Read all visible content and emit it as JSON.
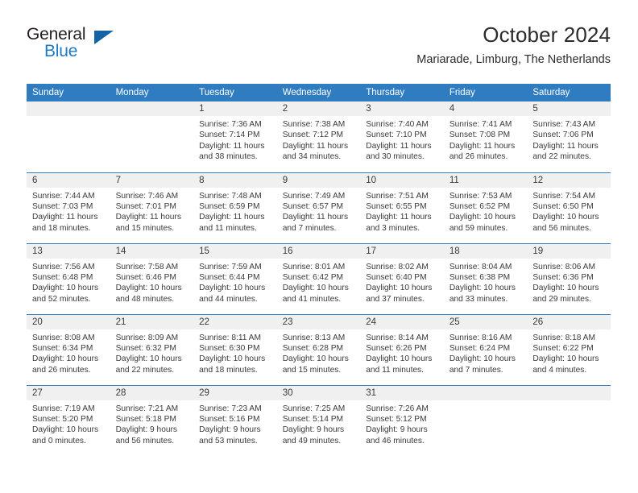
{
  "brand": {
    "name_top": "General",
    "name_bottom": "Blue",
    "accent_color": "#1f7ac4",
    "triangle_color": "#1463a5"
  },
  "header": {
    "title": "October 2024",
    "subtitle": "Mariarade, Limburg, The Netherlands"
  },
  "calendar": {
    "header_bg": "#2f7cc0",
    "daynum_bg": "#f0f0f0",
    "weekday_headers": [
      "Sunday",
      "Monday",
      "Tuesday",
      "Wednesday",
      "Thursday",
      "Friday",
      "Saturday"
    ],
    "weeks": [
      [
        {
          "day": "",
          "lines": []
        },
        {
          "day": "",
          "lines": []
        },
        {
          "day": "1",
          "lines": [
            "Sunrise: 7:36 AM",
            "Sunset: 7:14 PM",
            "Daylight: 11 hours",
            "and 38 minutes."
          ]
        },
        {
          "day": "2",
          "lines": [
            "Sunrise: 7:38 AM",
            "Sunset: 7:12 PM",
            "Daylight: 11 hours",
            "and 34 minutes."
          ]
        },
        {
          "day": "3",
          "lines": [
            "Sunrise: 7:40 AM",
            "Sunset: 7:10 PM",
            "Daylight: 11 hours",
            "and 30 minutes."
          ]
        },
        {
          "day": "4",
          "lines": [
            "Sunrise: 7:41 AM",
            "Sunset: 7:08 PM",
            "Daylight: 11 hours",
            "and 26 minutes."
          ]
        },
        {
          "day": "5",
          "lines": [
            "Sunrise: 7:43 AM",
            "Sunset: 7:06 PM",
            "Daylight: 11 hours",
            "and 22 minutes."
          ]
        }
      ],
      [
        {
          "day": "6",
          "lines": [
            "Sunrise: 7:44 AM",
            "Sunset: 7:03 PM",
            "Daylight: 11 hours",
            "and 18 minutes."
          ]
        },
        {
          "day": "7",
          "lines": [
            "Sunrise: 7:46 AM",
            "Sunset: 7:01 PM",
            "Daylight: 11 hours",
            "and 15 minutes."
          ]
        },
        {
          "day": "8",
          "lines": [
            "Sunrise: 7:48 AM",
            "Sunset: 6:59 PM",
            "Daylight: 11 hours",
            "and 11 minutes."
          ]
        },
        {
          "day": "9",
          "lines": [
            "Sunrise: 7:49 AM",
            "Sunset: 6:57 PM",
            "Daylight: 11 hours",
            "and 7 minutes."
          ]
        },
        {
          "day": "10",
          "lines": [
            "Sunrise: 7:51 AM",
            "Sunset: 6:55 PM",
            "Daylight: 11 hours",
            "and 3 minutes."
          ]
        },
        {
          "day": "11",
          "lines": [
            "Sunrise: 7:53 AM",
            "Sunset: 6:52 PM",
            "Daylight: 10 hours",
            "and 59 minutes."
          ]
        },
        {
          "day": "12",
          "lines": [
            "Sunrise: 7:54 AM",
            "Sunset: 6:50 PM",
            "Daylight: 10 hours",
            "and 56 minutes."
          ]
        }
      ],
      [
        {
          "day": "13",
          "lines": [
            "Sunrise: 7:56 AM",
            "Sunset: 6:48 PM",
            "Daylight: 10 hours",
            "and 52 minutes."
          ]
        },
        {
          "day": "14",
          "lines": [
            "Sunrise: 7:58 AM",
            "Sunset: 6:46 PM",
            "Daylight: 10 hours",
            "and 48 minutes."
          ]
        },
        {
          "day": "15",
          "lines": [
            "Sunrise: 7:59 AM",
            "Sunset: 6:44 PM",
            "Daylight: 10 hours",
            "and 44 minutes."
          ]
        },
        {
          "day": "16",
          "lines": [
            "Sunrise: 8:01 AM",
            "Sunset: 6:42 PM",
            "Daylight: 10 hours",
            "and 41 minutes."
          ]
        },
        {
          "day": "17",
          "lines": [
            "Sunrise: 8:02 AM",
            "Sunset: 6:40 PM",
            "Daylight: 10 hours",
            "and 37 minutes."
          ]
        },
        {
          "day": "18",
          "lines": [
            "Sunrise: 8:04 AM",
            "Sunset: 6:38 PM",
            "Daylight: 10 hours",
            "and 33 minutes."
          ]
        },
        {
          "day": "19",
          "lines": [
            "Sunrise: 8:06 AM",
            "Sunset: 6:36 PM",
            "Daylight: 10 hours",
            "and 29 minutes."
          ]
        }
      ],
      [
        {
          "day": "20",
          "lines": [
            "Sunrise: 8:08 AM",
            "Sunset: 6:34 PM",
            "Daylight: 10 hours",
            "and 26 minutes."
          ]
        },
        {
          "day": "21",
          "lines": [
            "Sunrise: 8:09 AM",
            "Sunset: 6:32 PM",
            "Daylight: 10 hours",
            "and 22 minutes."
          ]
        },
        {
          "day": "22",
          "lines": [
            "Sunrise: 8:11 AM",
            "Sunset: 6:30 PM",
            "Daylight: 10 hours",
            "and 18 minutes."
          ]
        },
        {
          "day": "23",
          "lines": [
            "Sunrise: 8:13 AM",
            "Sunset: 6:28 PM",
            "Daylight: 10 hours",
            "and 15 minutes."
          ]
        },
        {
          "day": "24",
          "lines": [
            "Sunrise: 8:14 AM",
            "Sunset: 6:26 PM",
            "Daylight: 10 hours",
            "and 11 minutes."
          ]
        },
        {
          "day": "25",
          "lines": [
            "Sunrise: 8:16 AM",
            "Sunset: 6:24 PM",
            "Daylight: 10 hours",
            "and 7 minutes."
          ]
        },
        {
          "day": "26",
          "lines": [
            "Sunrise: 8:18 AM",
            "Sunset: 6:22 PM",
            "Daylight: 10 hours",
            "and 4 minutes."
          ]
        }
      ],
      [
        {
          "day": "27",
          "lines": [
            "Sunrise: 7:19 AM",
            "Sunset: 5:20 PM",
            "Daylight: 10 hours",
            "and 0 minutes."
          ]
        },
        {
          "day": "28",
          "lines": [
            "Sunrise: 7:21 AM",
            "Sunset: 5:18 PM",
            "Daylight: 9 hours",
            "and 56 minutes."
          ]
        },
        {
          "day": "29",
          "lines": [
            "Sunrise: 7:23 AM",
            "Sunset: 5:16 PM",
            "Daylight: 9 hours",
            "and 53 minutes."
          ]
        },
        {
          "day": "30",
          "lines": [
            "Sunrise: 7:25 AM",
            "Sunset: 5:14 PM",
            "Daylight: 9 hours",
            "and 49 minutes."
          ]
        },
        {
          "day": "31",
          "lines": [
            "Sunrise: 7:26 AM",
            "Sunset: 5:12 PM",
            "Daylight: 9 hours",
            "and 46 minutes."
          ]
        },
        {
          "day": "",
          "lines": []
        },
        {
          "day": "",
          "lines": []
        }
      ]
    ]
  }
}
